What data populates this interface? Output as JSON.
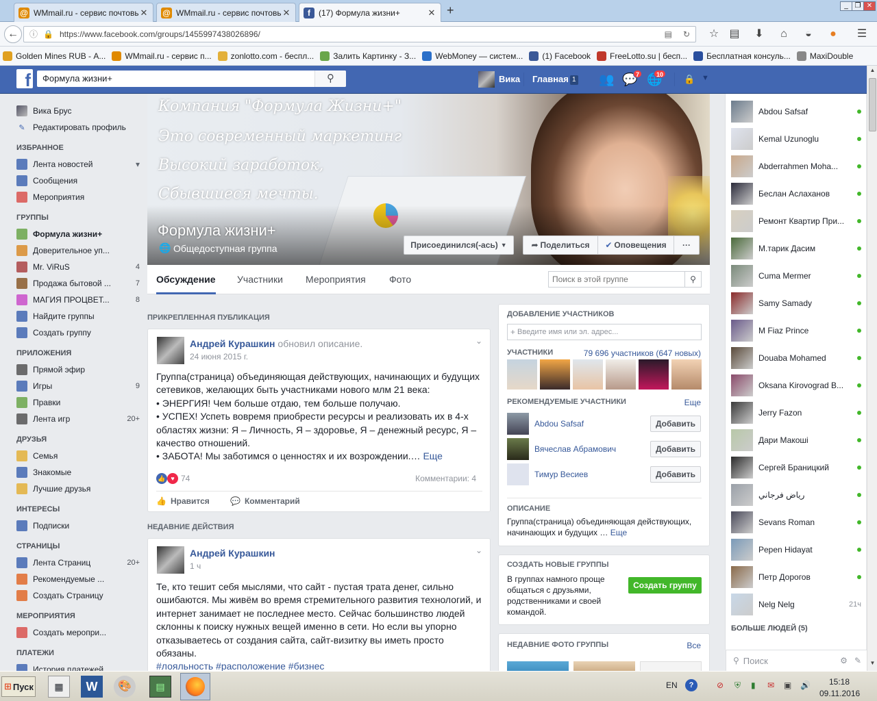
{
  "browser": {
    "tabs": [
      {
        "title": "WMmail.ru - сервис почтовы...",
        "icon": "wmmail-icon"
      },
      {
        "title": "WMmail.ru - сервис почтовы...",
        "icon": "wmmail-icon"
      },
      {
        "title": "(17) Формула жизни+",
        "icon": "facebook-icon"
      }
    ],
    "new_tab": "+",
    "url": "https://www.facebook.com/groups/1455997438026896/",
    "bookmarks": [
      {
        "label": "Golden Mines RUB - А...",
        "color": "#e0a020"
      },
      {
        "label": "WMmail.ru - сервис п...",
        "color": "#e08a00"
      },
      {
        "label": "zonlotto.com - беспл...",
        "color": "#e3b03a"
      },
      {
        "label": "Залить Картинку - З...",
        "color": "#6aa64a"
      },
      {
        "label": "WebMoney — систем...",
        "color": "#2a6fc9"
      },
      {
        "label": "(1) Facebook",
        "color": "#3b5998"
      },
      {
        "label": "FreeLotto.su | бесп...",
        "color": "#c0392b"
      },
      {
        "label": "Бесплатная консуль...",
        "color": "#2a4f9e"
      },
      {
        "label": "MaxiDouble",
        "color": "#888888"
      }
    ]
  },
  "fb": {
    "search_value": "Формула жизни+",
    "user_name": "Вика",
    "home_label": "Главная",
    "home_count": "1",
    "messages_badge": "7",
    "notifications_badge": "10"
  },
  "leftnav": {
    "profile_name": "Вика Брус",
    "edit_profile": "Редактировать профиль",
    "sections": [
      {
        "title": "ИЗБРАННОЕ",
        "items": [
          {
            "label": "Лента новостей",
            "count": "",
            "icon": "news-feed-icon",
            "color": "#4267b2"
          },
          {
            "label": "Сообщения",
            "count": "",
            "icon": "messages-icon",
            "color": "#4267b2"
          },
          {
            "label": "Мероприятия",
            "count": "",
            "icon": "calendar-icon",
            "color": "#d9534f"
          }
        ]
      },
      {
        "title": "ГРУППЫ",
        "items": [
          {
            "label": "Формула жизни+",
            "count": "",
            "icon": "group-icon",
            "color": "#6aa64a"
          },
          {
            "label": "Доверительное уп...",
            "count": "",
            "icon": "house-icon",
            "color": "#d98c2a"
          },
          {
            "label": "Mr. ViRuS",
            "count": "4",
            "icon": "virus-icon",
            "color": "#a44"
          },
          {
            "label": "Продажа бытовой ...",
            "count": "7",
            "icon": "gavel-icon",
            "color": "#8a5a2a"
          },
          {
            "label": "МАГИЯ ПРОЦВЕТ...",
            "count": "8",
            "icon": "rainbow-icon",
            "color": "#c94fc9"
          },
          {
            "label": "Найдите группы",
            "count": "",
            "icon": "compass-icon",
            "color": "#4267b2"
          },
          {
            "label": "Создать группу",
            "count": "",
            "icon": "plus-icon",
            "color": "#4267b2"
          }
        ]
      },
      {
        "title": "ПРИЛОЖЕНИЯ",
        "items": [
          {
            "label": "Прямой эфир",
            "count": "",
            "icon": "live-icon",
            "color": "#555"
          },
          {
            "label": "Игры",
            "count": "9",
            "icon": "games-icon",
            "color": "#4267b2"
          },
          {
            "label": "Правки",
            "count": "",
            "icon": "pencil-icon",
            "color": "#6aa64a"
          },
          {
            "label": "Лента игр",
            "count": "20+",
            "icon": "gamepad-icon",
            "color": "#555"
          }
        ]
      },
      {
        "title": "ДРУЗЬЯ",
        "items": [
          {
            "label": "Семья",
            "count": "",
            "icon": "star-icon",
            "color": "#e3b03a"
          },
          {
            "label": "Знакомые",
            "count": "",
            "icon": "friends-icon",
            "color": "#4267b2"
          },
          {
            "label": "Лучшие друзья",
            "count": "",
            "icon": "star-icon",
            "color": "#e3b03a"
          }
        ]
      },
      {
        "title": "ИНТЕРЕСЫ",
        "items": [
          {
            "label": "Подписки",
            "count": "",
            "icon": "rss-icon",
            "color": "#4267b2"
          }
        ]
      },
      {
        "title": "СТРАНИЦЫ",
        "items": [
          {
            "label": "Лента Страниц",
            "count": "20+",
            "icon": "pages-feed-icon",
            "color": "#4267b2"
          },
          {
            "label": "Рекомендуемые ...",
            "count": "",
            "icon": "flag-icon",
            "color": "#e06a2a"
          },
          {
            "label": "Создать Страницу",
            "count": "",
            "icon": "plus-icon",
            "color": "#e06a2a"
          }
        ]
      },
      {
        "title": "МЕРОПРИЯТИЯ",
        "items": [
          {
            "label": "Создать меропри...",
            "count": "",
            "icon": "event-plus-icon",
            "color": "#d9534f"
          }
        ]
      },
      {
        "title": "ПЛАТЕЖИ",
        "items": [
          {
            "label": "История платежей",
            "count": "",
            "icon": "payment-icon",
            "color": "#4267b2"
          }
        ]
      }
    ]
  },
  "cover": {
    "lines": [
      "Компания \"Формула Жизни+\"",
      "Это современный маркетинг",
      "Высокий заработок,",
      "Сбывшиеся мечты."
    ],
    "group_name": "Формула жизни+",
    "group_type": "Общедоступная группа",
    "joined_button": "Присоединился(-ась)",
    "share_button": "Поделиться",
    "notifications_button": "Оповещения",
    "more_button": "···"
  },
  "group_tabs": [
    "Обсуждение",
    "Участники",
    "Мероприятия",
    "Фото"
  ],
  "group_search_placeholder": "Поиск в этой группе",
  "pinned": {
    "section": "ПРИКРЕПЛЕННАЯ ПУБЛИКАЦИЯ",
    "author": "Андрей Курашкин",
    "action": "обновил описание.",
    "date": "24 июня 2015 г.",
    "text": "Группа(страница) объединяющая действующих, начинающих и будущих сетевиков, желающих быть участниками нового млм 21 века:\n• ЭНЕРГИЯ! Чем больше отдаю, тем больше получаю.\n• УСПЕХ! Успеть вовремя приобрести ресурсы и реализовать их в 4-х областях жизни: Я – Личность, Я – здоровье, Я – денежный ресурс, Я – качество отношений.\n• ЗАБОТА! Мы заботимся о ценностях и их возрождении.…",
    "more": "Еще",
    "reactions": "74",
    "comments": "Комментарии: 4",
    "like": "Нравится",
    "comment": "Комментарий"
  },
  "recent": {
    "section": "НЕДАВНИЕ ДЕЙСТВИЯ",
    "author": "Андрей Курашкин",
    "time": "1 ч",
    "text": "Те, кто тешит себя мыслями, что сайт - пустая трата денег, сильно ошибаются. Мы живём во время стремительного развития технологий, и интернет занимает не последнее место. Сейчас большинство людей склонны к поиску нужных вещей именно в сети. Но если вы упорно отказываетесь от создания сайта, сайт-визитку вы иметь просто обязаны.",
    "tags": "#лояльность #расположение #бизнес"
  },
  "sidebar": {
    "add_members_title": "ДОБАВЛЕНИЕ УЧАСТНИКОВ",
    "add_members_placeholder": "Введите имя или эл. адрес...",
    "members_title": "УЧАСТНИКИ",
    "members_count": "79 696 участников (647 новых)",
    "recommended_title": "РЕКОМЕНДУЕМЫЕ УЧАСТНИКИ",
    "recommended_more": "Еще",
    "recommended": [
      {
        "name": "Abdou Safsaf",
        "button": "Добавить"
      },
      {
        "name": "Вячеслав Абрамович",
        "button": "Добавить"
      },
      {
        "name": "Тимур Весиев",
        "button": "Добавить"
      }
    ],
    "description_title": "ОПИСАНИЕ",
    "description_text": "Группа(страница) объединяющая действующих, начинающих и будущих …",
    "description_more": "Еще",
    "create_title": "СОЗДАТЬ НОВЫЕ ГРУППЫ",
    "create_text": "В группах намного проще общаться с друзьями, родственниками и своей командой.",
    "create_button": "Создать группу",
    "photos_title": "НЕДАВНИЕ ФОТО ГРУППЫ",
    "photos_all": "Все"
  },
  "chat": {
    "contacts": [
      {
        "name": "Abdou Safsaf",
        "time": ""
      },
      {
        "name": "Kemal Uzunoglu",
        "time": ""
      },
      {
        "name": "Abderrahmen Moha...",
        "time": ""
      },
      {
        "name": "Беслан Аслаханов",
        "time": ""
      },
      {
        "name": "Ремонт Квартир При...",
        "time": ""
      },
      {
        "name": "M.тарик Дасим",
        "time": ""
      },
      {
        "name": "Cuma Mermer",
        "time": ""
      },
      {
        "name": "Samy Samady",
        "time": ""
      },
      {
        "name": "M Fiaz Prince",
        "time": ""
      },
      {
        "name": "Douaba Mohamed",
        "time": ""
      },
      {
        "name": "Oksana Kirovograd B...",
        "time": ""
      },
      {
        "name": "Jerry Fazon",
        "time": ""
      },
      {
        "name": "Дари Макоші",
        "time": ""
      },
      {
        "name": "Сергей Браницкий",
        "time": ""
      },
      {
        "name": "رياض فرجاني",
        "time": ""
      },
      {
        "name": "Sevans Roman",
        "time": ""
      },
      {
        "name": "Pepen Hidayat",
        "time": ""
      },
      {
        "name": "Петр Дорогов",
        "time": ""
      },
      {
        "name": "Nelg Nelg",
        "time": "21ч"
      }
    ],
    "more_people": "БОЛЬШЕ ЛЮДЕЙ (5)",
    "search_placeholder": "Поиск"
  },
  "taskbar": {
    "start": "Пуск",
    "lang": "EN",
    "time": "15:18",
    "date": "09.11.2016"
  }
}
